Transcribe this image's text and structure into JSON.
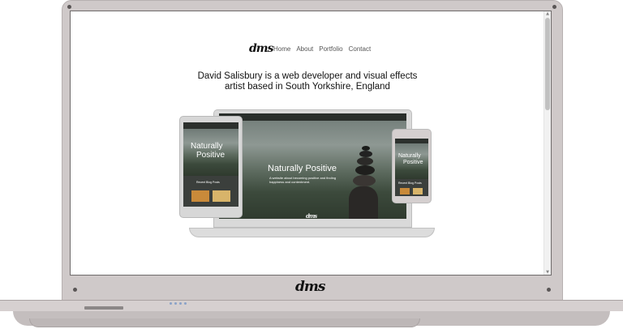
{
  "site": {
    "logo": "dms",
    "nav": [
      {
        "label": "Home"
      },
      {
        "label": "About"
      },
      {
        "label": "Portfolio"
      },
      {
        "label": "Contact"
      }
    ],
    "headline_line1": "David Salisbury is a web developer and visual effects",
    "headline_line2": "artist based in South Yorkshire, England"
  },
  "showcase": {
    "laptop_heading": "Naturally Positive",
    "laptop_sub_line1": "A website about becoming positive and finding",
    "laptop_sub_line2": "happiness and contentment.",
    "laptop_logo": "dms",
    "tablet_heading_line1": "Naturally",
    "tablet_heading_line2": "Positive",
    "tablet_section": "Recent Blog Posts",
    "phone_heading_line1": "Naturally",
    "phone_heading_line2": "Positive",
    "phone_section": "Recent Blog Posts"
  },
  "frame": {
    "bezel_logo": "dms"
  },
  "colors": {
    "frame": "#cfc9c9",
    "screen_border": "#6f6b6b",
    "text_dark": "#111111",
    "nav_text": "#555555",
    "led": "#8aa2c8"
  }
}
